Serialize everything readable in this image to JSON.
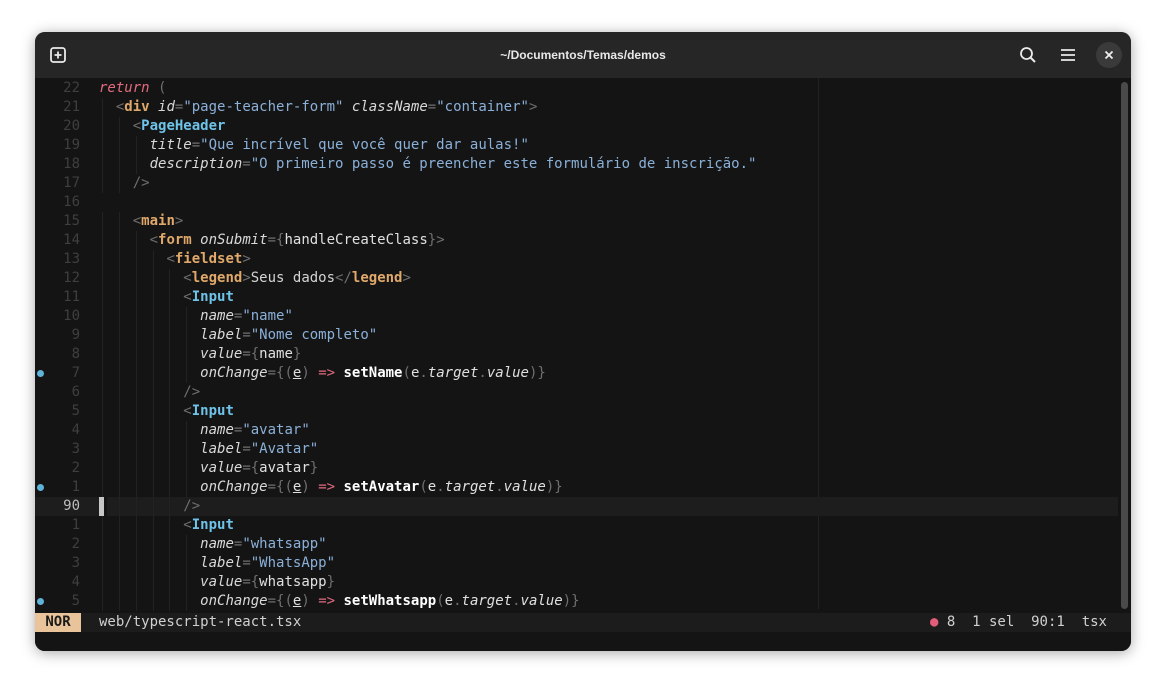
{
  "window": {
    "title": "~/Documentos/Temas/demos"
  },
  "status": {
    "mode": "NOR",
    "file": "web/typescript-react.tsx",
    "diagnostics_icon": "●",
    "diagnostics_count": "8",
    "selection": "1 sel",
    "position": "90:1",
    "language": "tsx"
  },
  "lines": [
    {
      "num": "22",
      "indent": 0,
      "dot": false,
      "tokens": [
        {
          "t": "return",
          "c": "kw"
        },
        {
          "t": " (",
          "c": "p"
        }
      ]
    },
    {
      "num": "21",
      "indent": 1,
      "dot": false,
      "tokens": [
        {
          "t": "<",
          "c": "p"
        },
        {
          "t": "div",
          "c": "tag"
        },
        {
          "t": " ",
          "c": "txt"
        },
        {
          "t": "id",
          "c": "attr"
        },
        {
          "t": "=",
          "c": "p"
        },
        {
          "t": "\"page-teacher-form\"",
          "c": "str"
        },
        {
          "t": " ",
          "c": "txt"
        },
        {
          "t": "className",
          "c": "attr"
        },
        {
          "t": "=",
          "c": "p"
        },
        {
          "t": "\"container\"",
          "c": "str"
        },
        {
          "t": ">",
          "c": "p"
        }
      ]
    },
    {
      "num": "20",
      "indent": 2,
      "dot": false,
      "tokens": [
        {
          "t": "<",
          "c": "p"
        },
        {
          "t": "PageHeader",
          "c": "comp"
        }
      ]
    },
    {
      "num": "19",
      "indent": 3,
      "dot": false,
      "tokens": [
        {
          "t": "title",
          "c": "attr"
        },
        {
          "t": "=",
          "c": "p"
        },
        {
          "t": "\"Que incrível que você quer dar aulas!\"",
          "c": "str"
        }
      ]
    },
    {
      "num": "18",
      "indent": 3,
      "dot": false,
      "tokens": [
        {
          "t": "description",
          "c": "attr"
        },
        {
          "t": "=",
          "c": "p"
        },
        {
          "t": "\"O primeiro passo é preencher este formulário de inscrição.\"",
          "c": "str"
        }
      ]
    },
    {
      "num": "17",
      "indent": 2,
      "dot": false,
      "tokens": [
        {
          "t": "/>",
          "c": "p"
        }
      ]
    },
    {
      "num": "16",
      "indent": 0,
      "dot": false,
      "tokens": []
    },
    {
      "num": "15",
      "indent": 2,
      "dot": false,
      "tokens": [
        {
          "t": "<",
          "c": "p"
        },
        {
          "t": "main",
          "c": "tag"
        },
        {
          "t": ">",
          "c": "p"
        }
      ]
    },
    {
      "num": "14",
      "indent": 3,
      "dot": false,
      "tokens": [
        {
          "t": "<",
          "c": "p"
        },
        {
          "t": "form",
          "c": "tag"
        },
        {
          "t": " ",
          "c": "txt"
        },
        {
          "t": "onSubmit",
          "c": "attr"
        },
        {
          "t": "={",
          "c": "p"
        },
        {
          "t": "handleCreateClass",
          "c": "var"
        },
        {
          "t": "}>",
          "c": "p"
        }
      ]
    },
    {
      "num": "13",
      "indent": 4,
      "dot": false,
      "tokens": [
        {
          "t": "<",
          "c": "p"
        },
        {
          "t": "fieldset",
          "c": "tag"
        },
        {
          "t": ">",
          "c": "p"
        }
      ]
    },
    {
      "num": "12",
      "indent": 5,
      "dot": false,
      "tokens": [
        {
          "t": "<",
          "c": "p"
        },
        {
          "t": "legend",
          "c": "tag"
        },
        {
          "t": ">",
          "c": "p"
        },
        {
          "t": "Seus dados",
          "c": "txt"
        },
        {
          "t": "</",
          "c": "p"
        },
        {
          "t": "legend",
          "c": "tag"
        },
        {
          "t": ">",
          "c": "p"
        }
      ]
    },
    {
      "num": "11",
      "indent": 5,
      "dot": false,
      "tokens": [
        {
          "t": "<",
          "c": "p"
        },
        {
          "t": "Input",
          "c": "comp"
        }
      ]
    },
    {
      "num": "10",
      "indent": 6,
      "dot": false,
      "tokens": [
        {
          "t": "name",
          "c": "attr"
        },
        {
          "t": "=",
          "c": "p"
        },
        {
          "t": "\"name\"",
          "c": "str"
        }
      ]
    },
    {
      "num": "9",
      "indent": 6,
      "dot": false,
      "tokens": [
        {
          "t": "label",
          "c": "attr"
        },
        {
          "t": "=",
          "c": "p"
        },
        {
          "t": "\"Nome completo\"",
          "c": "str"
        }
      ]
    },
    {
      "num": "8",
      "indent": 6,
      "dot": false,
      "tokens": [
        {
          "t": "value",
          "c": "attr"
        },
        {
          "t": "={",
          "c": "p"
        },
        {
          "t": "name",
          "c": "var"
        },
        {
          "t": "}",
          "c": "p"
        }
      ]
    },
    {
      "num": "7",
      "indent": 6,
      "dot": true,
      "tokens": [
        {
          "t": "onChange",
          "c": "attr"
        },
        {
          "t": "={(",
          "c": "p"
        },
        {
          "t": "e",
          "c": "par"
        },
        {
          "t": ")",
          "c": "p"
        },
        {
          "t": " => ",
          "c": "arrow"
        },
        {
          "t": "setName",
          "c": "fn"
        },
        {
          "t": "(",
          "c": "p"
        },
        {
          "t": "e",
          "c": "var"
        },
        {
          "t": ".",
          "c": "p"
        },
        {
          "t": "target",
          "c": "prop"
        },
        {
          "t": ".",
          "c": "p"
        },
        {
          "t": "value",
          "c": "prop"
        },
        {
          "t": ")}",
          "c": "p"
        }
      ]
    },
    {
      "num": "6",
      "indent": 5,
      "dot": false,
      "tokens": [
        {
          "t": "/>",
          "c": "p"
        }
      ]
    },
    {
      "num": "5",
      "indent": 5,
      "dot": false,
      "tokens": [
        {
          "t": "<",
          "c": "p"
        },
        {
          "t": "Input",
          "c": "comp"
        }
      ]
    },
    {
      "num": "4",
      "indent": 6,
      "dot": false,
      "tokens": [
        {
          "t": "name",
          "c": "attr"
        },
        {
          "t": "=",
          "c": "p"
        },
        {
          "t": "\"avatar\"",
          "c": "str"
        }
      ]
    },
    {
      "num": "3",
      "indent": 6,
      "dot": false,
      "tokens": [
        {
          "t": "label",
          "c": "attr"
        },
        {
          "t": "=",
          "c": "p"
        },
        {
          "t": "\"Avatar\"",
          "c": "str"
        }
      ]
    },
    {
      "num": "2",
      "indent": 6,
      "dot": false,
      "tokens": [
        {
          "t": "value",
          "c": "attr"
        },
        {
          "t": "={",
          "c": "p"
        },
        {
          "t": "avatar",
          "c": "var"
        },
        {
          "t": "}",
          "c": "p"
        }
      ]
    },
    {
      "num": "1",
      "indent": 6,
      "dot": true,
      "tokens": [
        {
          "t": "onChange",
          "c": "attr"
        },
        {
          "t": "={(",
          "c": "p"
        },
        {
          "t": "e",
          "c": "par"
        },
        {
          "t": ")",
          "c": "p"
        },
        {
          "t": " => ",
          "c": "arrow"
        },
        {
          "t": "setAvatar",
          "c": "fn"
        },
        {
          "t": "(",
          "c": "p"
        },
        {
          "t": "e",
          "c": "var"
        },
        {
          "t": ".",
          "c": "p"
        },
        {
          "t": "target",
          "c": "prop"
        },
        {
          "t": ".",
          "c": "p"
        },
        {
          "t": "value",
          "c": "prop"
        },
        {
          "t": ")}",
          "c": "p"
        }
      ]
    },
    {
      "num": "90",
      "indent": 5,
      "dot": false,
      "current": true,
      "tokens": [
        {
          "t": "/>",
          "c": "p"
        }
      ]
    },
    {
      "num": "1",
      "indent": 5,
      "dot": false,
      "tokens": [
        {
          "t": "<",
          "c": "p"
        },
        {
          "t": "Input",
          "c": "comp"
        }
      ]
    },
    {
      "num": "2",
      "indent": 6,
      "dot": false,
      "tokens": [
        {
          "t": "name",
          "c": "attr"
        },
        {
          "t": "=",
          "c": "p"
        },
        {
          "t": "\"whatsapp\"",
          "c": "str"
        }
      ]
    },
    {
      "num": "3",
      "indent": 6,
      "dot": false,
      "tokens": [
        {
          "t": "label",
          "c": "attr"
        },
        {
          "t": "=",
          "c": "p"
        },
        {
          "t": "\"WhatsApp\"",
          "c": "str"
        }
      ]
    },
    {
      "num": "4",
      "indent": 6,
      "dot": false,
      "tokens": [
        {
          "t": "value",
          "c": "attr"
        },
        {
          "t": "={",
          "c": "p"
        },
        {
          "t": "whatsapp",
          "c": "var"
        },
        {
          "t": "}",
          "c": "p"
        }
      ]
    },
    {
      "num": "5",
      "indent": 6,
      "dot": true,
      "tokens": [
        {
          "t": "onChange",
          "c": "attr"
        },
        {
          "t": "={(",
          "c": "p"
        },
        {
          "t": "e",
          "c": "par"
        },
        {
          "t": ")",
          "c": "p"
        },
        {
          "t": " => ",
          "c": "arrow"
        },
        {
          "t": "setWhatsapp",
          "c": "fn"
        },
        {
          "t": "(",
          "c": "p"
        },
        {
          "t": "e",
          "c": "var"
        },
        {
          "t": ".",
          "c": "p"
        },
        {
          "t": "target",
          "c": "prop"
        },
        {
          "t": ".",
          "c": "p"
        },
        {
          "t": "value",
          "c": "prop"
        },
        {
          "t": ")}",
          "c": "p"
        }
      ]
    }
  ]
}
